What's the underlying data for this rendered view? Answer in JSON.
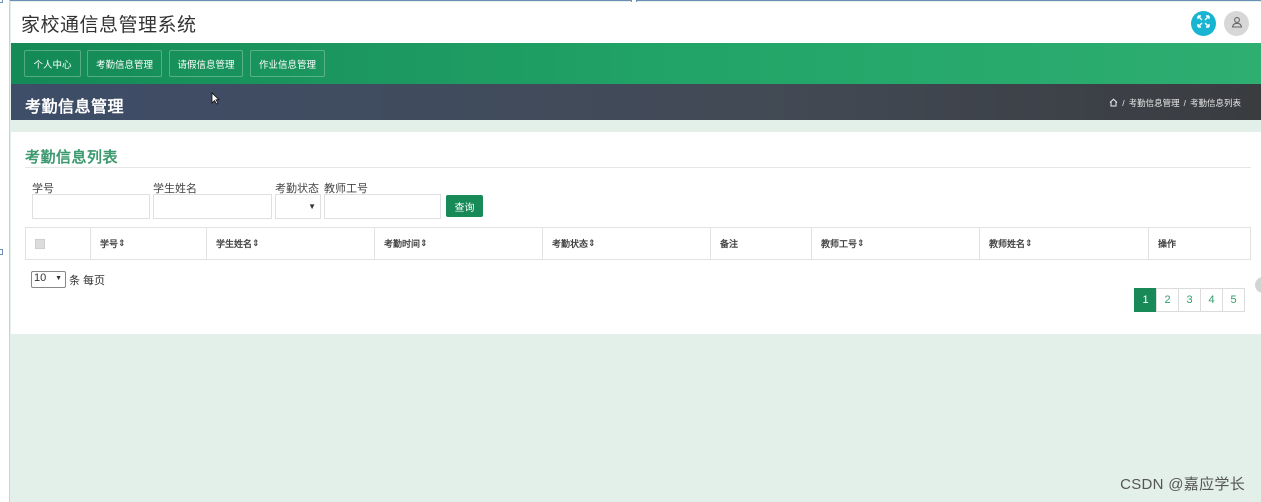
{
  "app": {
    "title": "家校通信息管理系统"
  },
  "nav": {
    "items": [
      {
        "label": "个人中心"
      },
      {
        "label": "考勤信息管理"
      },
      {
        "label": "请假信息管理"
      },
      {
        "label": "作业信息管理"
      }
    ]
  },
  "pagebar": {
    "title": "考勤信息管理",
    "breadcrumb": [
      "考勤信息管理",
      "考勤信息列表"
    ],
    "separator": "/"
  },
  "card": {
    "title": "考勤信息列表"
  },
  "filters": {
    "student_id_label": "学号",
    "student_name_label": "学生姓名",
    "status_label": "考勤状态",
    "teacher_id_label": "教师工号",
    "search_button": "查询"
  },
  "table": {
    "columns": [
      "学号",
      "学生姓名",
      "考勤时间",
      "考勤状态",
      "备注",
      "教师工号",
      "教师姓名",
      "操作"
    ]
  },
  "pagination": {
    "page_size": "10",
    "page_size_suffix": "条 每页",
    "pages": [
      "1",
      "2",
      "3",
      "4",
      "5"
    ],
    "current": "1"
  },
  "watermark": "CSDN @嘉应学长",
  "colors": {
    "nav_green": "#1f9c62",
    "accent_green": "#178a57",
    "title_green": "#3d9a6f",
    "pagebar_dark": "#424a55",
    "teal_icon": "#17b5d2"
  },
  "icons": {
    "fullscreen": "expand-icon",
    "user": "user-icon",
    "home": "home-icon"
  }
}
